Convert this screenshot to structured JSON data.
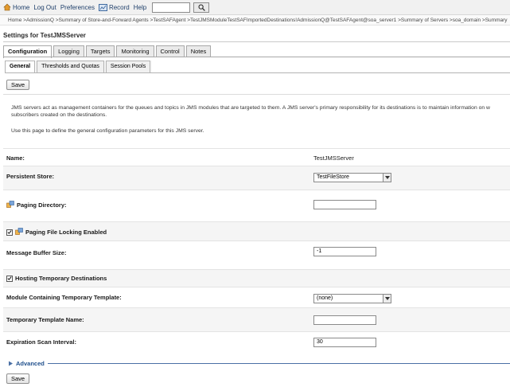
{
  "topbar": {
    "home": "Home",
    "logout": "Log Out",
    "preferences": "Preferences",
    "record": "Record",
    "help": "Help",
    "search_value": ""
  },
  "breadcrumb": "Home >AdmissionQ >Summary of Store-and-Forward Agents >TestSAFAgent >TestJMSModuleTestSAFImportedDestinations!AdmissionQ@TestSAFAgent@soa_server1 >Summary of Servers >soa_domain >Summary",
  "page_title": "Settings for TestJMSServer",
  "tabs": [
    "Configuration",
    "Logging",
    "Targets",
    "Monitoring",
    "Control",
    "Notes"
  ],
  "subtabs": [
    "General",
    "Thresholds and Quotas",
    "Session Pools"
  ],
  "save_label": "Save",
  "description": {
    "line1": "JMS servers act as management containers for the queues and topics in JMS modules that are targeted to them. A JMS server's primary responsibility for its destinations is to maintain information on w",
    "line2": "subscribers created on the destinations.",
    "line3": "Use this page to define the general configuration parameters for this JMS server."
  },
  "fields": {
    "name": {
      "label": "Name:",
      "value": "TestJMSServer"
    },
    "persistent_store": {
      "label": "Persistent Store:",
      "value": "TestFileStore"
    },
    "paging_directory": {
      "label": "Paging Directory:",
      "value": ""
    },
    "paging_file_locking": {
      "label": "Paging File Locking Enabled",
      "checked": true
    },
    "message_buffer_size": {
      "label": "Message Buffer Size:",
      "value": "-1"
    },
    "hosting_temp_dest": {
      "label": "Hosting Temporary Destinations",
      "checked": true
    },
    "module_temp_template": {
      "label": "Module Containing Temporary Template:",
      "value": "(none)"
    },
    "temp_template_name": {
      "label": "Temporary Template Name:",
      "value": ""
    },
    "expiration_scan_interval": {
      "label": "Expiration Scan Interval:",
      "value": "30"
    }
  },
  "advanced_label": "Advanced",
  "colors": {
    "link": "#1f3f6a",
    "accent": "#4a6fa5",
    "icon_orange": "#e07a1f"
  }
}
